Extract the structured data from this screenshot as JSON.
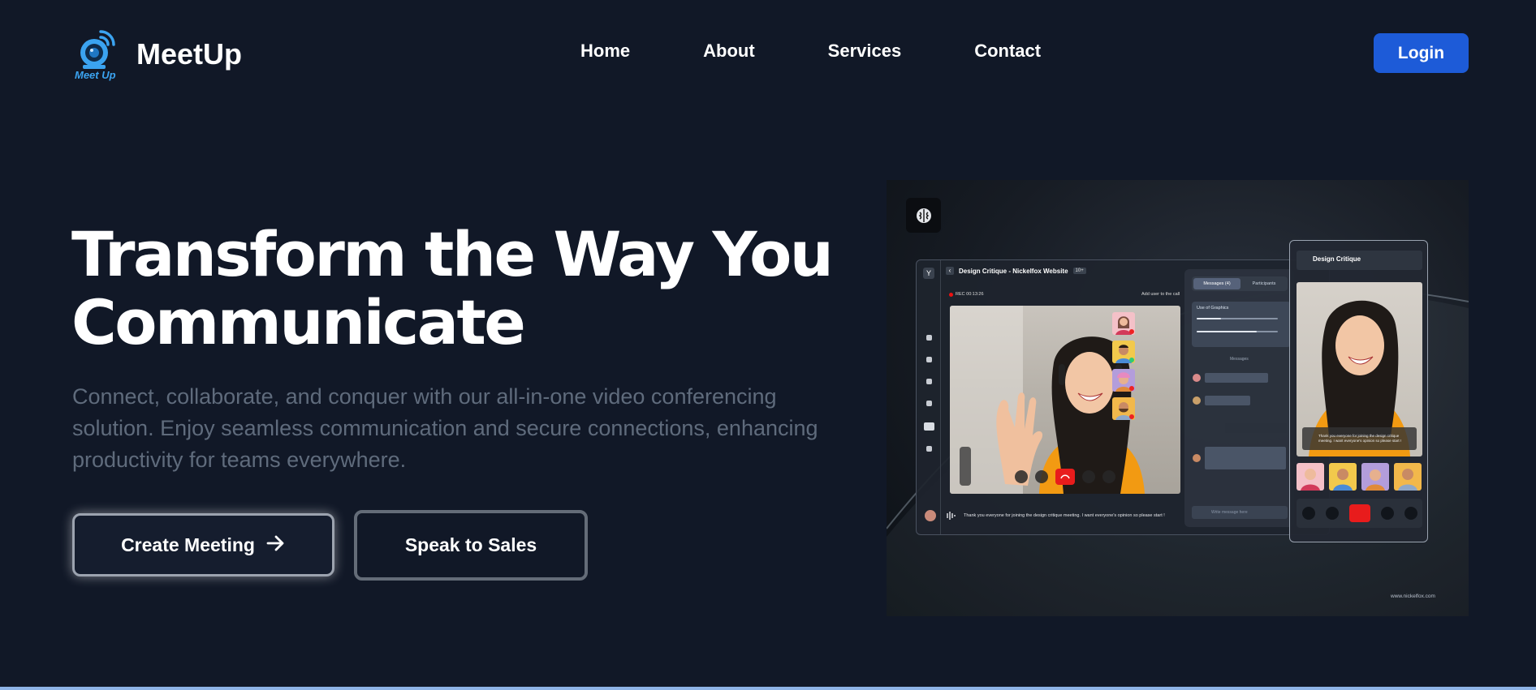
{
  "nav": {
    "brand_name": "MeetUp",
    "logo_text": "Meet Up",
    "links": [
      "Home",
      "About",
      "Services",
      "Contact"
    ],
    "login_label": "Login"
  },
  "hero": {
    "title": "Transform the Way You Communicate",
    "subtitle": "Connect, collaborate, and conquer with our all-in-one video conferencing solution. Enjoy seamless communication and secure connections, enhancing productivity for teams everywhere.",
    "create_meeting_label": "Create Meeting",
    "speak_to_sales_label": "Speak to Sales"
  },
  "mockup": {
    "window_title": "Design Critique - Nickelfox Website",
    "participant_count": "10+",
    "rec_label": "REC  00:13:26",
    "add_user_label": "Add user to the call",
    "tabs": [
      "Messages (4)",
      "Participants"
    ],
    "use_of_graphics": "Use of Graphics",
    "messages_divider": "Messages",
    "compose_placeholder": "Write message here",
    "bottom_message": "Thank you everyone for joining the design critique meeting. I want everyone's opinion so please start !",
    "phone_title": "Design Critique",
    "phone_caption": "Thank you everyone for joining the design critique meeting. I want everyone's opinion so please start !",
    "watermark": "www.nickelfox.com"
  },
  "colors": {
    "background": "#111827",
    "login_button": "#1d5bd8",
    "subtitle_text": "#5f6b7c",
    "logo_accent": "#3ba3f0"
  }
}
